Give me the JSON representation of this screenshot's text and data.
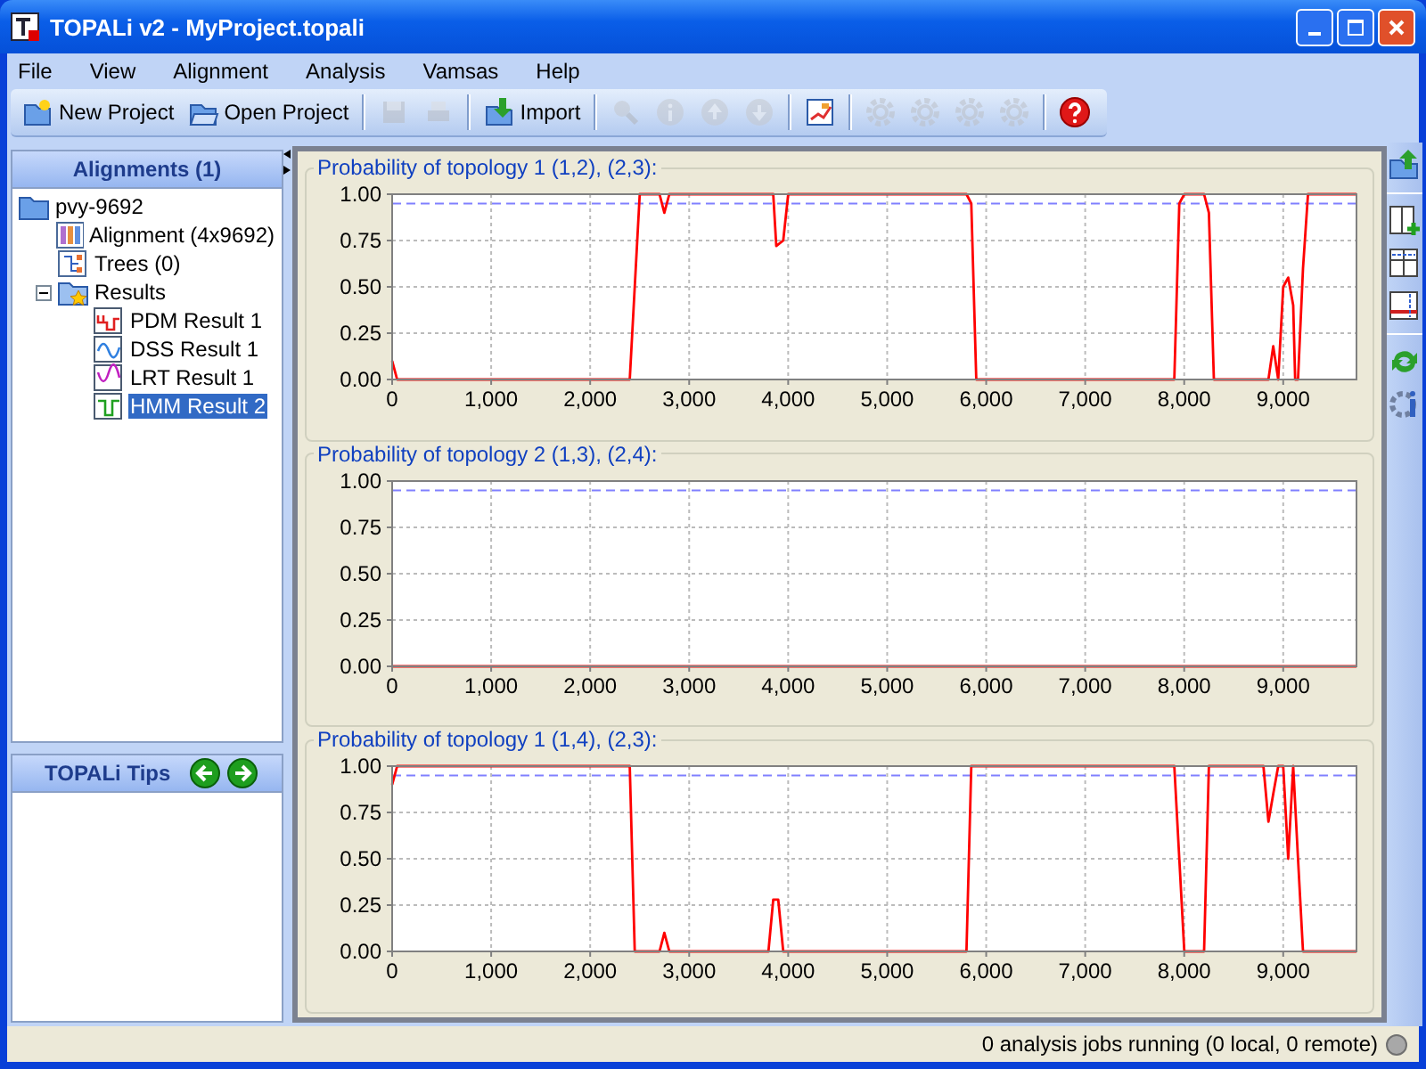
{
  "window": {
    "title": "TOPALi v2 - MyProject.topali"
  },
  "menu": [
    "File",
    "View",
    "Alignment",
    "Analysis",
    "Vamsas",
    "Help"
  ],
  "toolbar": [
    {
      "kind": "new",
      "label": "New Project",
      "disabled": false
    },
    {
      "kind": "open",
      "label": "Open Project",
      "disabled": false
    },
    {
      "kind": "sep"
    },
    {
      "kind": "save",
      "disabled": true
    },
    {
      "kind": "print",
      "disabled": true
    },
    {
      "kind": "sep"
    },
    {
      "kind": "import",
      "label": "Import",
      "disabled": false
    },
    {
      "kind": "sep"
    },
    {
      "kind": "find",
      "disabled": true
    },
    {
      "kind": "info",
      "disabled": true
    },
    {
      "kind": "up",
      "disabled": true
    },
    {
      "kind": "down",
      "disabled": true
    },
    {
      "kind": "sep"
    },
    {
      "kind": "chart",
      "disabled": false
    },
    {
      "kind": "sep"
    },
    {
      "kind": "gear",
      "disabled": true
    },
    {
      "kind": "gear",
      "disabled": true
    },
    {
      "kind": "gear",
      "disabled": true
    },
    {
      "kind": "gear",
      "disabled": true
    },
    {
      "kind": "sep"
    },
    {
      "kind": "help",
      "disabled": false
    }
  ],
  "alignments_panel": {
    "title": "Alignments (1)",
    "tree": {
      "label": "pvy-9692",
      "children": [
        {
          "kind": "alignment",
          "label": "Alignment (4x9692)",
          "selected": false
        },
        {
          "kind": "trees",
          "label": "Trees (0)",
          "selected": false
        },
        {
          "kind": "results",
          "label": "Results",
          "selected": false,
          "expanded": true,
          "children": [
            {
              "kind": "pdm",
              "label": "PDM Result 1",
              "selected": false
            },
            {
              "kind": "dss",
              "label": "DSS Result 1",
              "selected": false
            },
            {
              "kind": "lrt",
              "label": "LRT Result 1",
              "selected": false
            },
            {
              "kind": "hmm",
              "label": "HMM Result 2",
              "selected": true
            }
          ]
        }
      ]
    }
  },
  "tips_panel": {
    "title": "TOPALi Tips"
  },
  "charts": [
    {
      "chart_data": {
        "type": "line",
        "title": "Probability of topology 1 (1,2), (2,3):",
        "x": [
          0,
          50,
          2400,
          2500,
          2700,
          2750,
          2800,
          3850,
          3880,
          3950,
          4000,
          5800,
          5850,
          5900,
          7900,
          7950,
          8000,
          8200,
          8250,
          8300,
          8850,
          8900,
          8950,
          9000,
          9050,
          9100,
          9120,
          9150,
          9200,
          9250,
          9740
        ],
        "series": [
          {
            "color": "#ff0000",
            "values": [
              0.1,
              0,
              0,
              1,
              1,
              0.9,
              1,
              1,
              0.72,
              0.75,
              1,
              1,
              0.95,
              0,
              0,
              0.95,
              1,
              1,
              0.9,
              0,
              0,
              0.18,
              0,
              0.5,
              0.55,
              0.4,
              0,
              0,
              0.6,
              1,
              1
            ]
          },
          {
            "color": "#8080ff",
            "line_style": "dashed",
            "values": [
              0.95,
              0.95,
              0.95,
              0.95,
              0.95,
              0.95,
              0.95,
              0.95,
              0.95,
              0.95,
              0.95,
              0.95,
              0.95,
              0.95,
              0.95,
              0.95,
              0.95,
              0.95,
              0.95,
              0.95,
              0.95,
              0.95,
              0.95,
              0.95,
              0.95,
              0.95,
              0.95,
              0.95,
              0.95,
              0.95,
              0.95
            ]
          }
        ],
        "xlim": [
          0,
          9740
        ],
        "ylim": [
          0,
          1
        ],
        "xticks": [
          {
            "value": 0,
            "label": "0"
          },
          {
            "value": 1000,
            "label": "1,000"
          },
          {
            "value": 2000,
            "label": "2,000"
          },
          {
            "value": 3000,
            "label": "3,000"
          },
          {
            "value": 4000,
            "label": "4,000"
          },
          {
            "value": 5000,
            "label": "5,000"
          },
          {
            "value": 6000,
            "label": "6,000"
          },
          {
            "value": 7000,
            "label": "7,000"
          },
          {
            "value": 8000,
            "label": "8,000"
          },
          {
            "value": 9000,
            "label": "9,000"
          }
        ],
        "yticks": [
          {
            "value": 0,
            "label": "0.00"
          },
          {
            "value": 0.25,
            "label": "0.25"
          },
          {
            "value": 0.5,
            "label": "0.50"
          },
          {
            "value": 0.75,
            "label": "0.75"
          },
          {
            "value": 1,
            "label": "1.00"
          }
        ],
        "grid": true
      }
    },
    {
      "chart_data": {
        "type": "line",
        "title": "Probability of topology 2 (1,3), (2,4):",
        "x": [
          0,
          9740
        ],
        "series": [
          {
            "color": "#ff0000",
            "values": [
              0,
              0
            ]
          },
          {
            "color": "#8080ff",
            "line_style": "dashed",
            "values": [
              0.95,
              0.95
            ]
          }
        ],
        "xlim": [
          0,
          9740
        ],
        "ylim": [
          0,
          1
        ],
        "xticks": [
          {
            "value": 0,
            "label": "0"
          },
          {
            "value": 1000,
            "label": "1,000"
          },
          {
            "value": 2000,
            "label": "2,000"
          },
          {
            "value": 3000,
            "label": "3,000"
          },
          {
            "value": 4000,
            "label": "4,000"
          },
          {
            "value": 5000,
            "label": "5,000"
          },
          {
            "value": 6000,
            "label": "6,000"
          },
          {
            "value": 7000,
            "label": "7,000"
          },
          {
            "value": 8000,
            "label": "8,000"
          },
          {
            "value": 9000,
            "label": "9,000"
          }
        ],
        "yticks": [
          {
            "value": 0,
            "label": "0.00"
          },
          {
            "value": 0.25,
            "label": "0.25"
          },
          {
            "value": 0.5,
            "label": "0.50"
          },
          {
            "value": 0.75,
            "label": "0.75"
          },
          {
            "value": 1,
            "label": "1.00"
          }
        ],
        "grid": true
      }
    },
    {
      "chart_data": {
        "type": "line",
        "title": "Probability of topology 1 (1,4), (2,3):",
        "x": [
          0,
          50,
          2400,
          2450,
          2700,
          2750,
          2800,
          3800,
          3850,
          3900,
          3950,
          5800,
          5850,
          7900,
          7950,
          8000,
          8200,
          8250,
          8800,
          8850,
          8900,
          8950,
          9000,
          9050,
          9100,
          9150,
          9200,
          9740
        ],
        "series": [
          {
            "color": "#ff0000",
            "values": [
              0.9,
              1,
              1,
              0,
              0,
              0.1,
              0,
              0,
              0.28,
              0.28,
              0,
              0,
              1,
              1,
              0.5,
              0,
              0,
              1,
              1,
              0.7,
              0.85,
              1,
              1,
              0.5,
              1,
              0.5,
              0,
              0
            ]
          },
          {
            "color": "#8080ff",
            "line_style": "dashed",
            "values": [
              0.95,
              0.95,
              0.95,
              0.95,
              0.95,
              0.95,
              0.95,
              0.95,
              0.95,
              0.95,
              0.95,
              0.95,
              0.95,
              0.95,
              0.95,
              0.95,
              0.95,
              0.95,
              0.95,
              0.95,
              0.95,
              0.95,
              0.95,
              0.95,
              0.95,
              0.95,
              0.95,
              0.95
            ]
          }
        ],
        "xlim": [
          0,
          9740
        ],
        "ylim": [
          0,
          1
        ],
        "xticks": [
          {
            "value": 0,
            "label": "0"
          },
          {
            "value": 1000,
            "label": "1,000"
          },
          {
            "value": 2000,
            "label": "2,000"
          },
          {
            "value": 3000,
            "label": "3,000"
          },
          {
            "value": 4000,
            "label": "4,000"
          },
          {
            "value": 5000,
            "label": "5,000"
          },
          {
            "value": 6000,
            "label": "6,000"
          },
          {
            "value": 7000,
            "label": "7,000"
          },
          {
            "value": 8000,
            "label": "8,000"
          },
          {
            "value": 9000,
            "label": "9,000"
          }
        ],
        "yticks": [
          {
            "value": 0,
            "label": "0.00"
          },
          {
            "value": 0.25,
            "label": "0.25"
          },
          {
            "value": 0.5,
            "label": "0.50"
          },
          {
            "value": 0.75,
            "label": "0.75"
          },
          {
            "value": 1,
            "label": "1.00"
          }
        ],
        "grid": true
      }
    }
  ],
  "status_bar": {
    "text": "0 analysis jobs running (0 local, 0 remote)"
  }
}
